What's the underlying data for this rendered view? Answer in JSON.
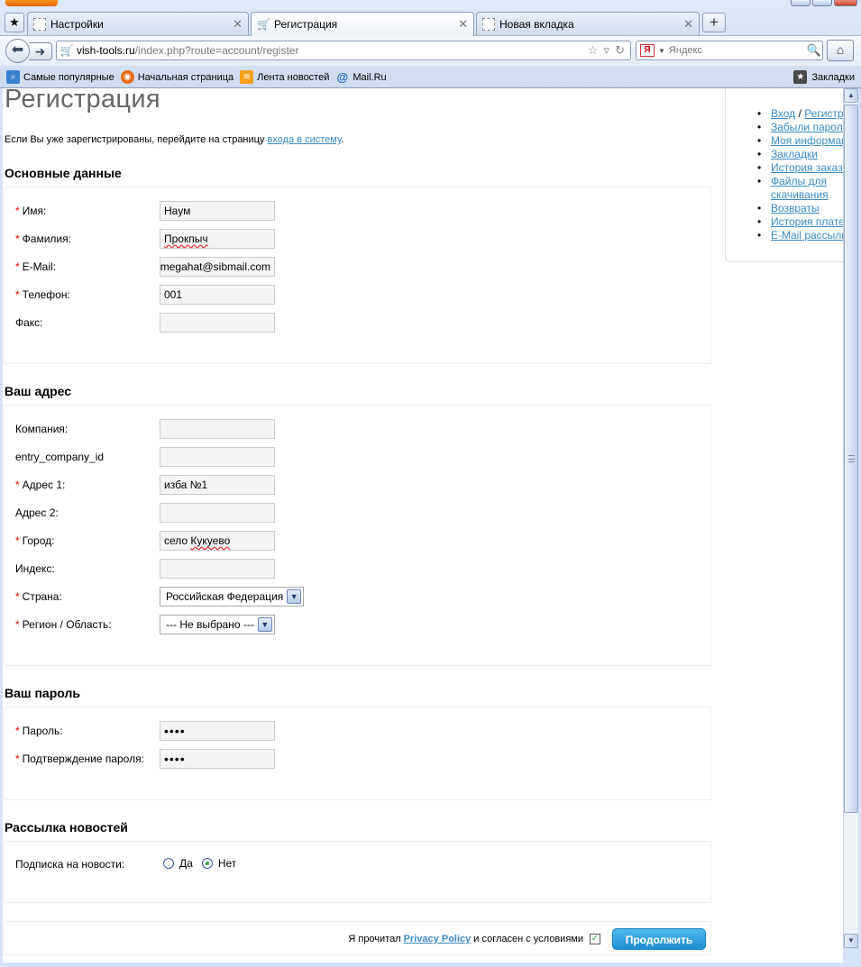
{
  "browser": {
    "tabs": [
      {
        "title": "Настройки",
        "icon": "blank-page-icon"
      },
      {
        "title": "Регистрация",
        "icon": "shopping-cart-icon"
      },
      {
        "title": "Новая вкладка",
        "icon": "blank-page-icon"
      }
    ],
    "url_host": "vish-tools.ru",
    "url_path": "/index.php?route=account/register",
    "search_placeholder": "Яндекс",
    "search_engine_glyph": "Я",
    "bookmarks": [
      {
        "label": "Самые популярные",
        "icon": "most-visited-icon"
      },
      {
        "label": "Начальная страница",
        "icon": "firefox-icon"
      },
      {
        "label": "Лента новостей",
        "icon": "rss-icon"
      },
      {
        "label": "Mail.Ru",
        "icon": "at-sign-icon"
      }
    ],
    "bookmarks_menu": "Закладки"
  },
  "page": {
    "title": "Регистрация",
    "login_note_prefix": "Если Вы уже зарегистрированы, перейдите на страницу",
    "login_link": "входа в систему",
    "login_note_suffix": "."
  },
  "personal": {
    "heading": "Основные данные",
    "firstname_label": "Имя:",
    "firstname_value": "Наум",
    "lastname_label": "Фамилия:",
    "lastname_value": "Прокпыч",
    "email_label": "E-Mail:",
    "email_value": "megahat@sibmail.com",
    "phone_label": "Телефон:",
    "phone_value": "001",
    "fax_label": "Факс:",
    "fax_value": ""
  },
  "address": {
    "heading": "Ваш адрес",
    "company_label": "Компания:",
    "company_value": "",
    "company_id_label": "entry_company_id",
    "company_id_value": "",
    "address1_label": "Адрес 1:",
    "address1_value": "изба №1",
    "address2_label": "Адрес 2:",
    "address2_value": "",
    "city_label": "Город:",
    "city_prefix": "село ",
    "city_misspelled": "Кукуево",
    "postcode_label": "Индекс:",
    "postcode_value": "",
    "country_label": "Страна:",
    "country_value": "Российская Федерация",
    "region_label": "Регион / Область:",
    "region_value": "--- Не выбрано ---"
  },
  "password": {
    "heading": "Ваш пароль",
    "password_label": "Пароль:",
    "password_value": "1234",
    "confirm_label": "Подтверждение пароля:",
    "confirm_value": "1234"
  },
  "newsletter": {
    "heading": "Рассылка новостей",
    "label": "Подписка на новости:",
    "yes": "Да",
    "no": "Нет",
    "selected": "no"
  },
  "agreement": {
    "prefix": "Я прочитал",
    "link": "Privacy Policy",
    "suffix": "и согласен с условиями",
    "checked": true,
    "continue": "Продолжить"
  },
  "sidebar": {
    "login": "Вход",
    "separator": "/",
    "register": "Регистрация",
    "items": [
      "Забыли пароль?",
      "Моя информация",
      "Закладки",
      "История заказов",
      "Файлы для скачивания",
      "Возвраты",
      "История платежей",
      "E-Mail рассылка"
    ]
  },
  "colors": {
    "link": "#3a8bc5",
    "required": "#ff0000",
    "button": "#1e8fd4"
  }
}
